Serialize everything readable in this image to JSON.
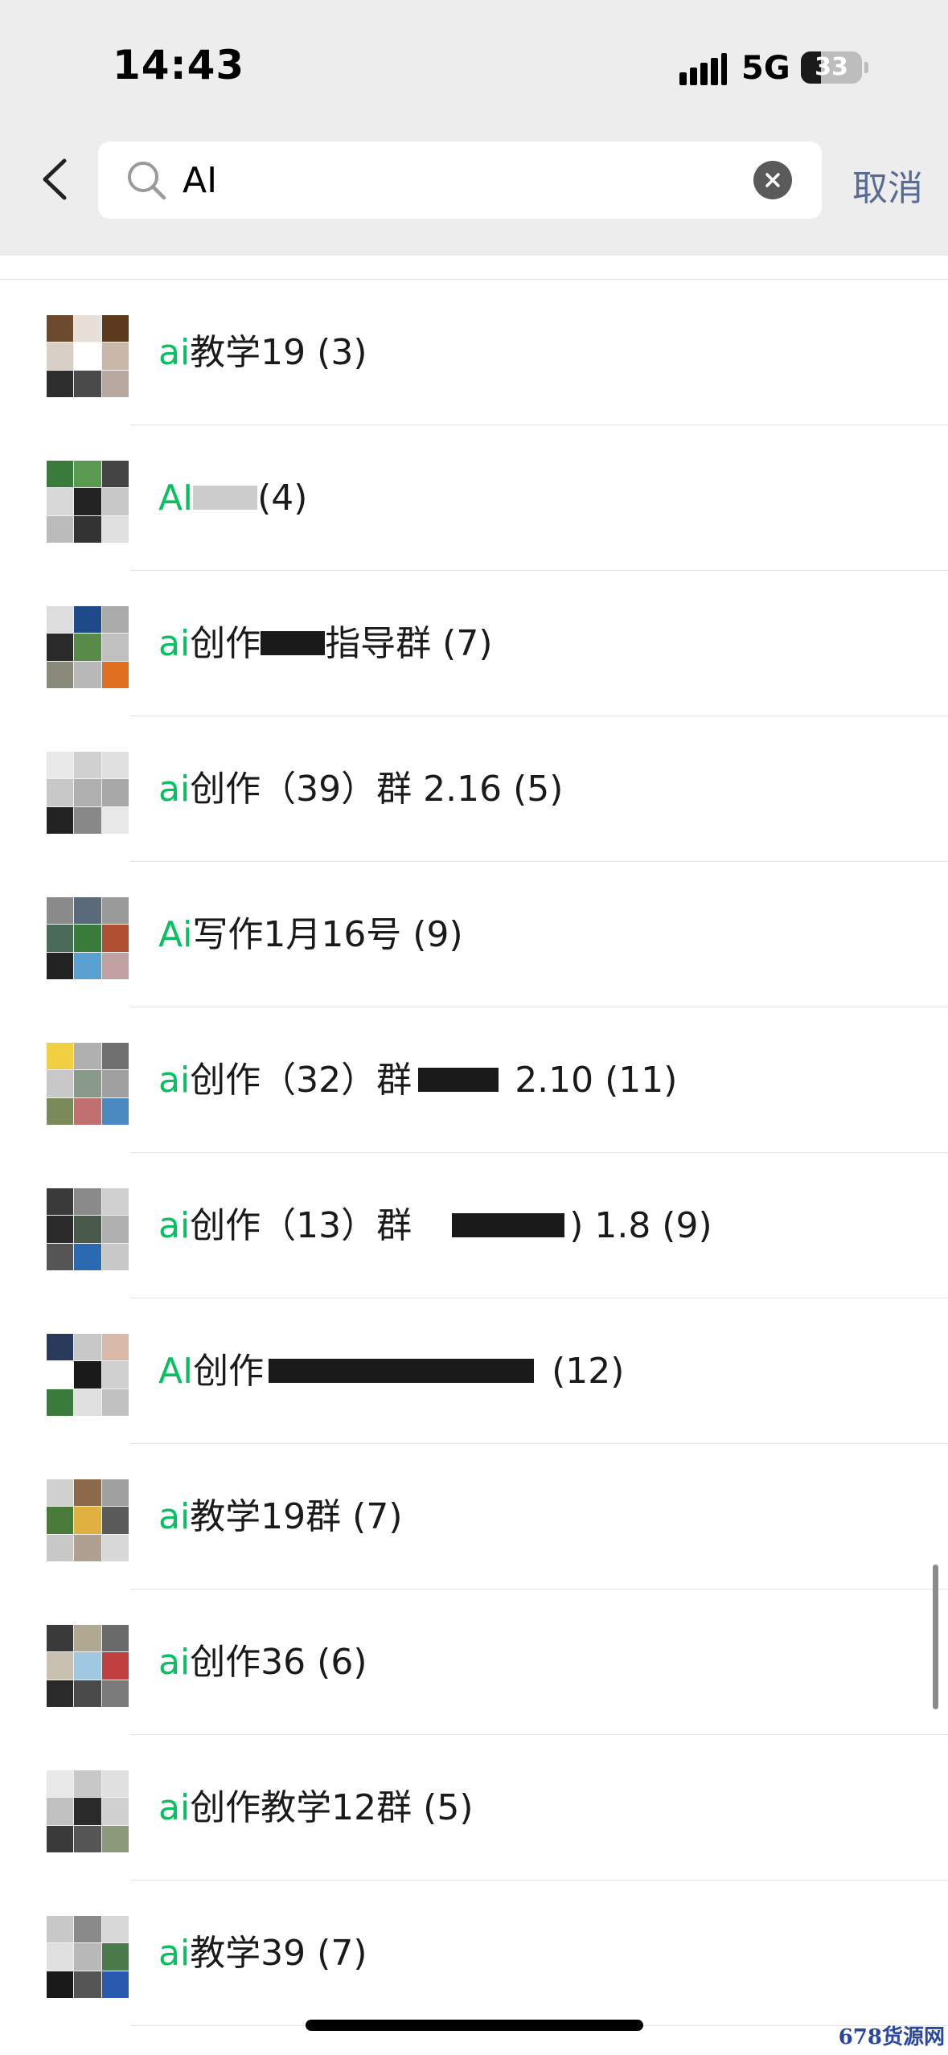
{
  "status_bar": {
    "time": "14:43",
    "network": "5G",
    "battery": "33",
    "battery_level": 0.33,
    "signal_icon": "cellular-signal-icon"
  },
  "search": {
    "query": "AI",
    "placeholder": "",
    "cancel_label": "取消",
    "back_icon": "chevron-left-icon",
    "search_icon": "magnifier-icon",
    "clear_icon": "clear-circle-x-icon"
  },
  "colors": {
    "highlight": "#07c160",
    "cancel": "#576b95",
    "header_bg": "#ededed"
  },
  "results": [
    {
      "highlight": "ai",
      "title": "教学19 (3)"
    },
    {
      "highlight": "AI",
      "title": "(4)"
    },
    {
      "highlight": "ai",
      "title": "创作",
      "title_after": "指导群 (7)"
    },
    {
      "highlight": "ai",
      "title": "创作（39）群 2.16 (5)"
    },
    {
      "highlight": "Ai",
      "title": "写作1月16号 (9)"
    },
    {
      "highlight": "ai",
      "title": "创作（32）群",
      "title_after": "2.10 (11)"
    },
    {
      "highlight": "ai",
      "title": "创作（13）群",
      "title_after": ") 1.8 (9)"
    },
    {
      "highlight": "AI",
      "title": "创作",
      "title_after": "(12)"
    },
    {
      "highlight": "ai",
      "title": "教学19群 (7)"
    },
    {
      "highlight": "ai",
      "title": "创作36 (6)"
    },
    {
      "highlight": "ai",
      "title": "创作教学12群 (5)"
    },
    {
      "highlight": "ai",
      "title": "教学39 (7)"
    }
  ],
  "watermark": "678货源网"
}
